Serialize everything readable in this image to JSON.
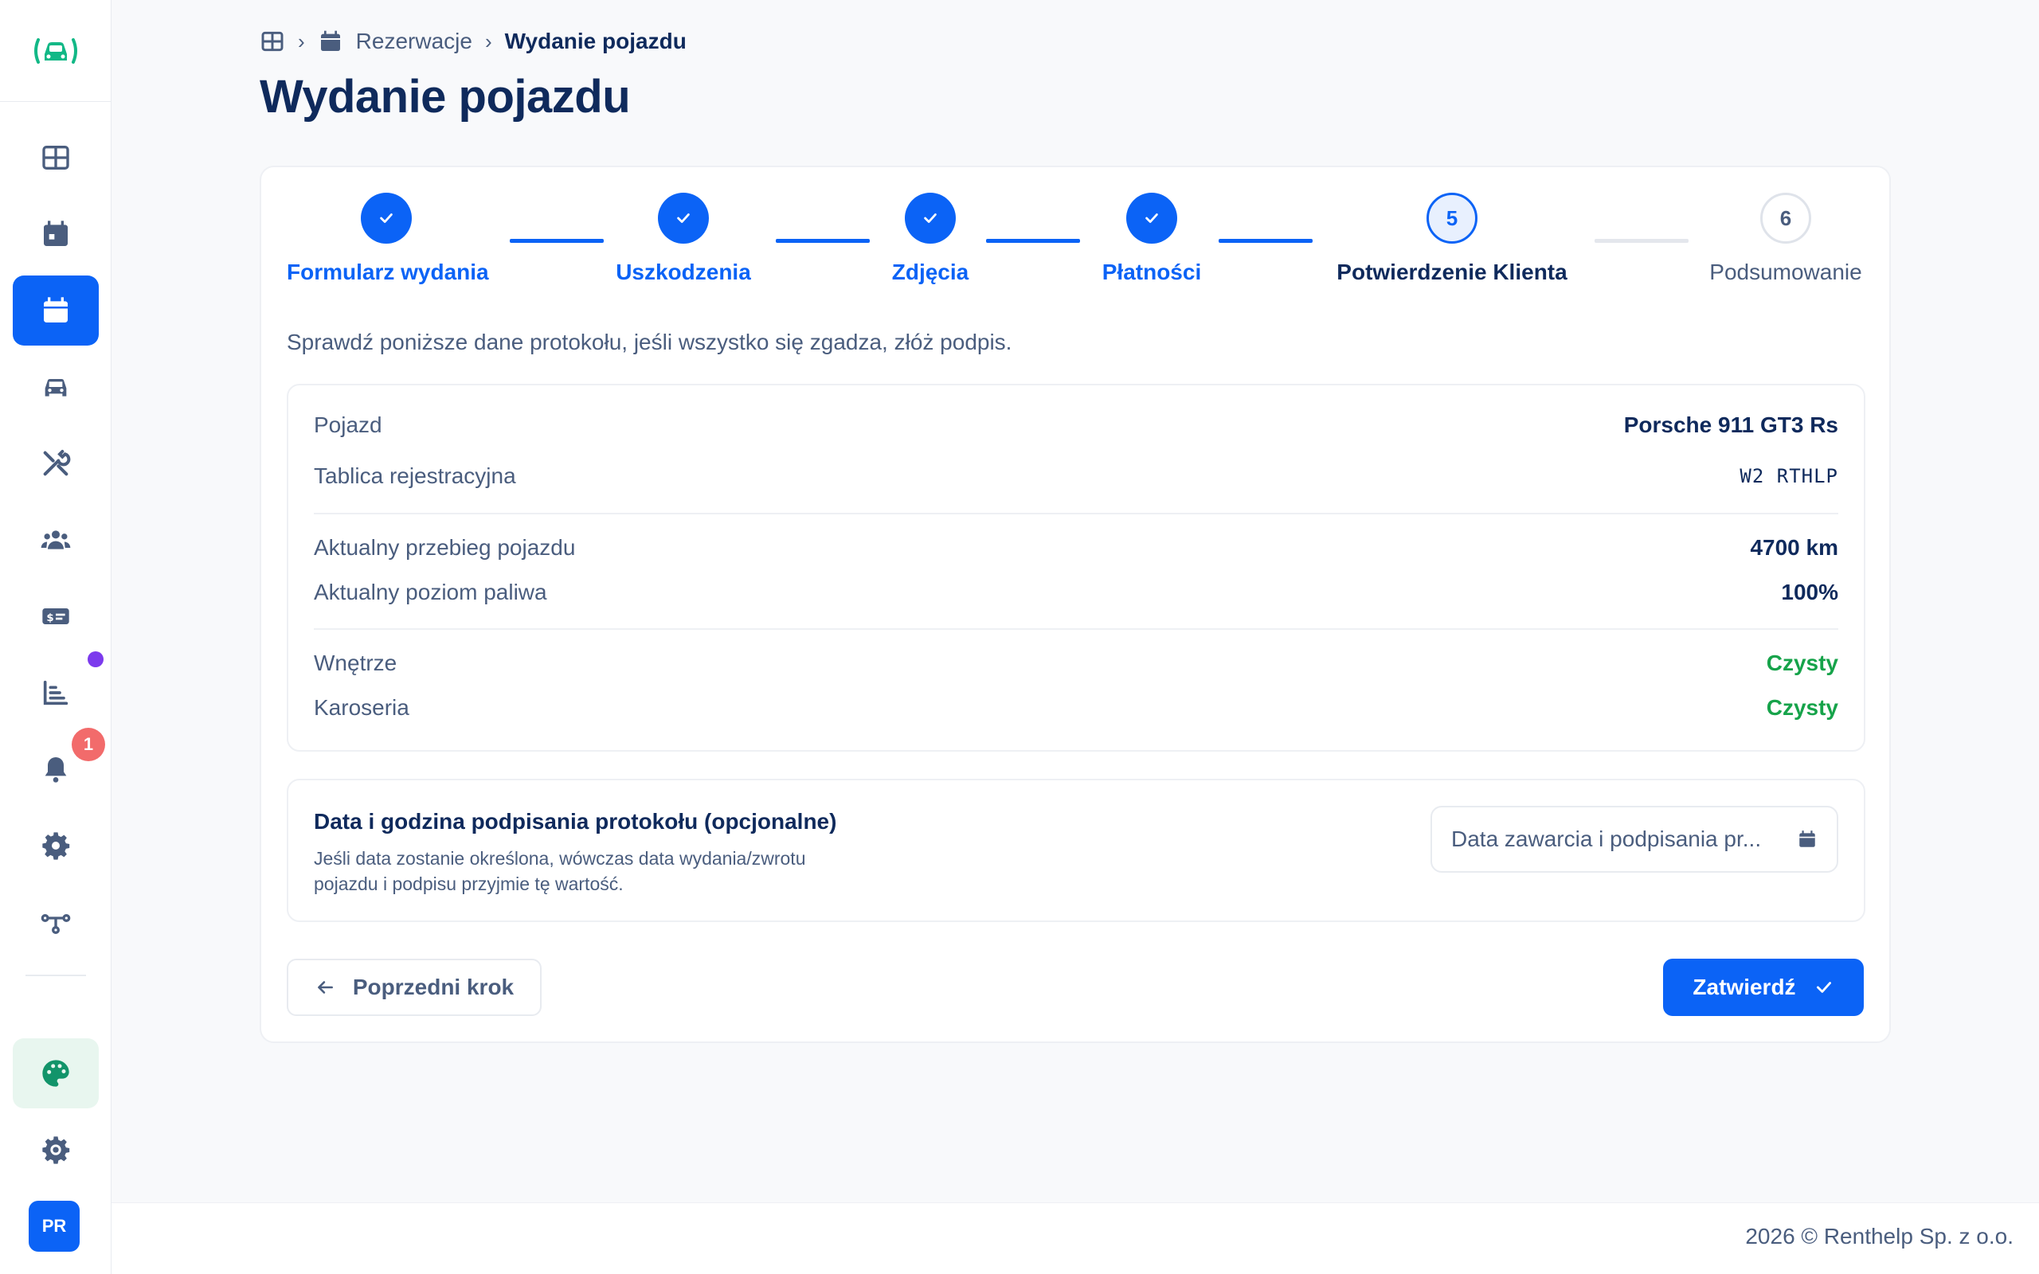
{
  "sidebar": {
    "logo": "car-wireless-logo",
    "items": [
      {
        "name": "dashboard",
        "icon": "grid-icon"
      },
      {
        "name": "calendar",
        "icon": "calendar-icon"
      },
      {
        "name": "reservations",
        "icon": "calendar-icon"
      },
      {
        "name": "vehicles",
        "icon": "car-icon"
      },
      {
        "name": "service",
        "icon": "tools-icon"
      },
      {
        "name": "customers",
        "icon": "users-icon"
      },
      {
        "name": "payments",
        "icon": "money-icon"
      },
      {
        "name": "reports",
        "icon": "bar-chart-icon"
      },
      {
        "name": "notifications",
        "icon": "bell-icon"
      },
      {
        "name": "settings",
        "icon": "gear-icon"
      },
      {
        "name": "integrations",
        "icon": "network-icon"
      }
    ],
    "notification_count": "1",
    "avatar": "PR"
  },
  "breadcrumb": {
    "section": "Rezerwacje",
    "current": "Wydanie pojazdu"
  },
  "page_title": "Wydanie pojazdu",
  "stepper": {
    "steps": [
      {
        "number": "1",
        "label": "Formularz wydania",
        "state": "done"
      },
      {
        "number": "2",
        "label": "Uszkodzenia",
        "state": "done"
      },
      {
        "number": "3",
        "label": "Zdjęcia",
        "state": "done"
      },
      {
        "number": "4",
        "label": "Płatności",
        "state": "done"
      },
      {
        "number": "5",
        "label": "Potwierdzenie Klienta",
        "state": "current"
      },
      {
        "number": "6",
        "label": "Podsumowanie",
        "state": "todo"
      }
    ]
  },
  "intro": "Sprawdź poniższe dane protokołu, jeśli wszystko się zgadza, złóż podpis.",
  "summary": {
    "vehicle_label": "Pojazd",
    "vehicle_value": "Porsche 911 GT3 Rs",
    "plate_label": "Tablica rejestracyjna",
    "plate_value": "W2 RTHLP",
    "mileage_label": "Aktualny przebieg pojazdu",
    "mileage_value": "4700 km",
    "fuel_label": "Aktualny poziom paliwa",
    "fuel_value": "100%",
    "interior_label": "Wnętrze",
    "interior_value": "Czysty",
    "body_label": "Karoseria",
    "body_value": "Czysty"
  },
  "signing": {
    "title": "Data i godzina podpisania protokołu (opcjonalne)",
    "description": "Jeśli data zostanie określona, wówczas data wydania/zwrotu pojazdu i podpisu przyjmie tę wartość.",
    "placeholder": "Data zawarcia i podpisania pr..."
  },
  "buttons": {
    "prev": "Poprzedni krok",
    "confirm": "Zatwierdź"
  },
  "footer": "2026 © Renthelp Sp. z o.o.",
  "colors": {
    "primary": "#0b63f6",
    "text": "#0f2a5c",
    "muted": "#4a5d7e",
    "success": "#16a34a",
    "badge": "#f26b6b",
    "dot": "#7c3aed"
  }
}
